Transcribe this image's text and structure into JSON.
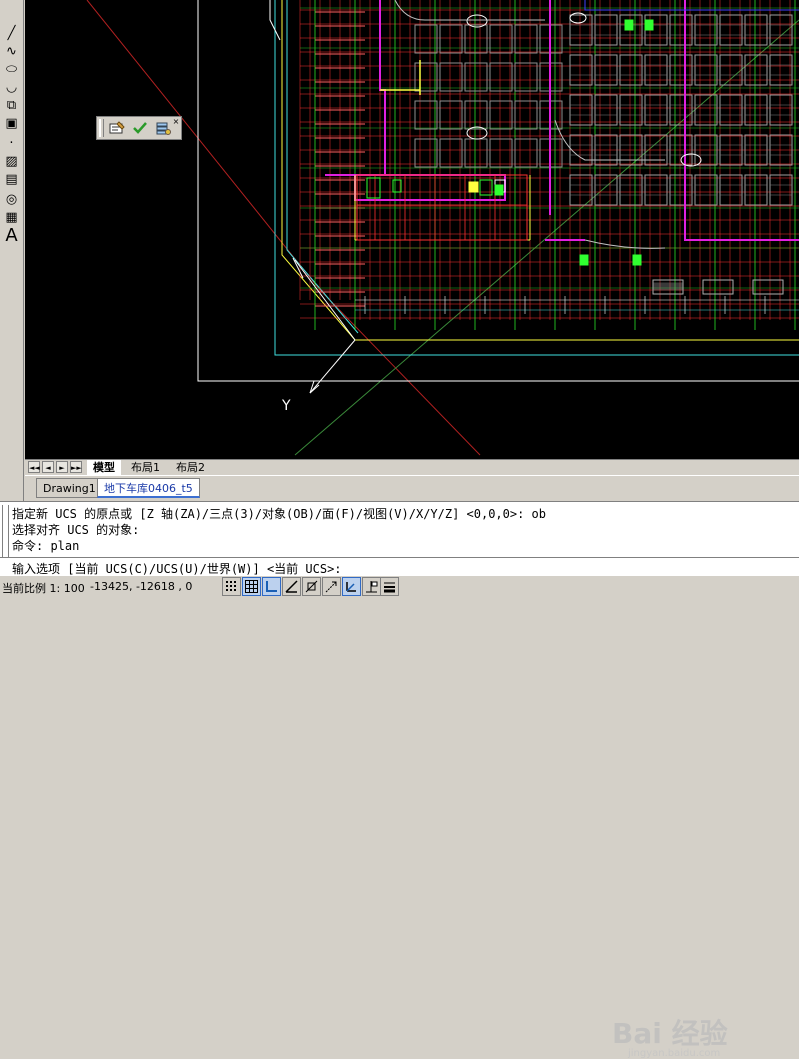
{
  "left_toolbar": {
    "tools": [
      {
        "icon": "line-icon",
        "glyph": "╱"
      },
      {
        "icon": "spline-icon",
        "glyph": "∿"
      },
      {
        "icon": "ellipse-icon",
        "glyph": "⬭"
      },
      {
        "icon": "ellipse-arc-icon",
        "glyph": "◡"
      },
      {
        "icon": "insert-block-icon",
        "glyph": "⧉"
      },
      {
        "icon": "make-block-icon",
        "glyph": "▣"
      },
      {
        "icon": "point-icon",
        "glyph": "·"
      },
      {
        "icon": "hatch-icon",
        "glyph": "▨"
      },
      {
        "icon": "gradient-icon",
        "glyph": "▤"
      },
      {
        "icon": "region-icon",
        "glyph": "◎"
      },
      {
        "icon": "table-icon",
        "glyph": "▦"
      },
      {
        "icon": "mtext-icon",
        "glyph": "A"
      }
    ]
  },
  "float_toolbar": {
    "buttons": [
      "edit-attribute-icon",
      "checkmark-icon",
      "layer-properties-icon"
    ],
    "close_glyph": "×"
  },
  "viewport": {
    "ucs_axis_label": "Y"
  },
  "layout_tabs": {
    "model": "模型",
    "layout1": "布局1",
    "layout2": "布局2",
    "nav": [
      "◄◄",
      "◄",
      "►",
      "►►"
    ]
  },
  "doc_tabs": {
    "tab1": "Drawing1",
    "tab2": "地下车库0406_t5"
  },
  "command_window": {
    "line1": "指定新 UCS 的原点或 [Z 轴(ZA)/三点(3)/对象(OB)/面(F)/视图(V)/X/Y/Z] <0,0,0>: ob",
    "line2": "选择对齐 UCS 的对象:",
    "line3": "命令: plan",
    "prompt": "输入选项 [当前 UCS(C)/UCS(U)/世界(W)] <当前 UCS>:"
  },
  "status_bar": {
    "scale": "当前比例 1: 100",
    "coords": "-13425, -12618 , 0",
    "toggles": [
      "snap-icon",
      "grid-icon",
      "ortho-icon",
      "polar-icon",
      "osnap-icon",
      "otrack-icon",
      "ducs-icon",
      "dyn-icon",
      "lineweight-icon"
    ]
  },
  "watermark": {
    "text": "Bai 经验",
    "sub": "jingyan.baidu.com"
  },
  "colors": {
    "canvas": "#000000",
    "grid_red": "#ff3030",
    "magenta": "#e020e0",
    "yellow": "#ffff40",
    "green": "#30ff30",
    "cyan": "#40e0e0",
    "white": "#ffffff",
    "blue": "#4040ff"
  }
}
